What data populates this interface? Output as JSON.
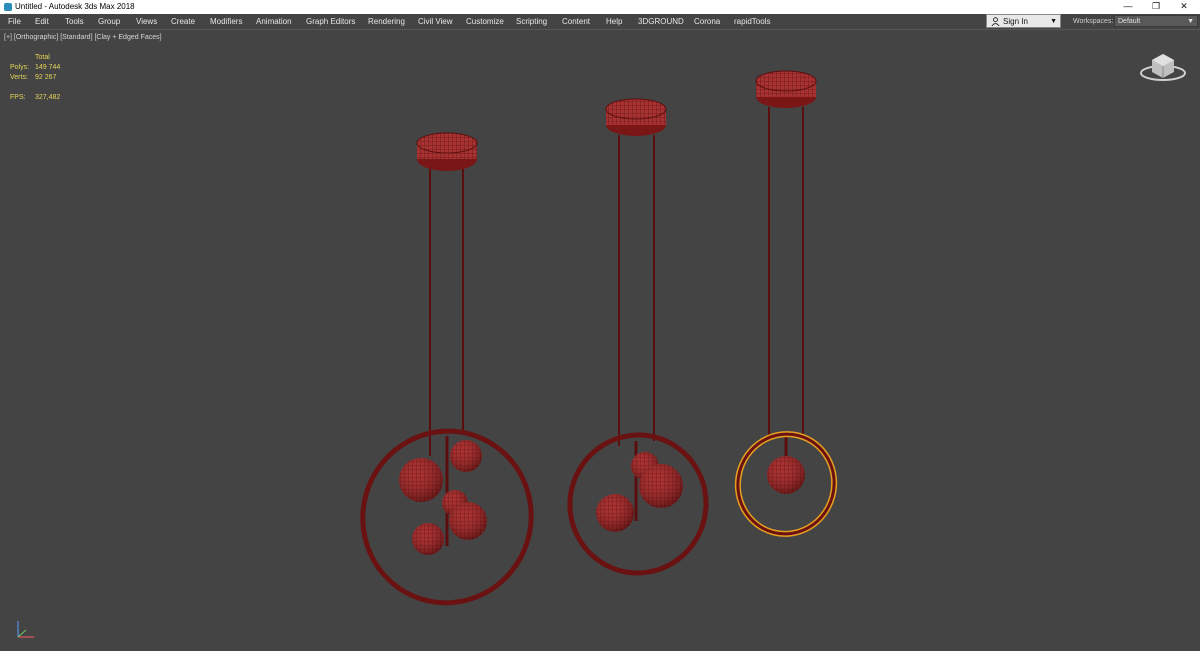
{
  "window": {
    "title": "Untitled - Autodesk 3ds Max 2018",
    "minimize": "—",
    "restore": "❐",
    "close": "✕"
  },
  "menu": [
    "File",
    "Edit",
    "Tools",
    "Group",
    "Views",
    "Create",
    "Modifiers",
    "Animation",
    "Graph Editors",
    "Rendering",
    "Civil View",
    "Customize",
    "Scripting",
    "Content",
    "Help",
    "3DGROUND",
    "Corona",
    "rapidTools"
  ],
  "account": {
    "sign_in": "Sign In",
    "caret": "▼",
    "icon": "user-icon"
  },
  "workspaces": {
    "label": "Workspaces:",
    "selected": "Default",
    "caret": "▼"
  },
  "viewport": {
    "label": "[+] [Orthographic] [Standard] [Clay + Edged Faces]",
    "stats": {
      "total_label": "Total",
      "polys_label": "Polys:",
      "polys_value": "149 744",
      "verts_label": "Verts:",
      "verts_value": "92 267",
      "fps_label": "FPS:",
      "fps_value": "327,482"
    }
  },
  "colors": {
    "viewport_bg": "#444444",
    "model": "#7a1616",
    "model_light": "#a83232",
    "selected": "#e6a020",
    "stats": "#e6d55a"
  }
}
